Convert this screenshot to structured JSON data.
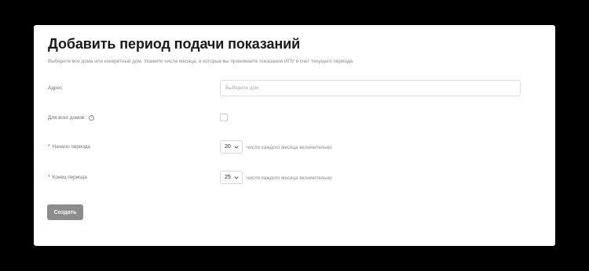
{
  "form": {
    "title": "Добавить период подачи показаний",
    "subtitle": "Выберите все дома или конкретный дом. Укажите числа месяца, в которые вы принимаете показания ИПУ в счет текущего периода.",
    "address": {
      "label": "Адрес",
      "placeholder": "Выберите дом"
    },
    "all_houses": {
      "label": "Для всех домов",
      "help_icon": "question-circle-icon",
      "checked": false
    },
    "period_start": {
      "required_mark": "*",
      "label": "Начало периода",
      "value": "20",
      "hint": "число каждого месяца включительно"
    },
    "period_end": {
      "required_mark": "*",
      "label": "Конец периода",
      "value": "25",
      "hint": "число каждого месяца включительно"
    },
    "submit_label": "Создать"
  },
  "colors": {
    "backdrop": "#000000",
    "card": "#ffffff",
    "required": "#e24a3b",
    "button": "#8c8c8c"
  }
}
